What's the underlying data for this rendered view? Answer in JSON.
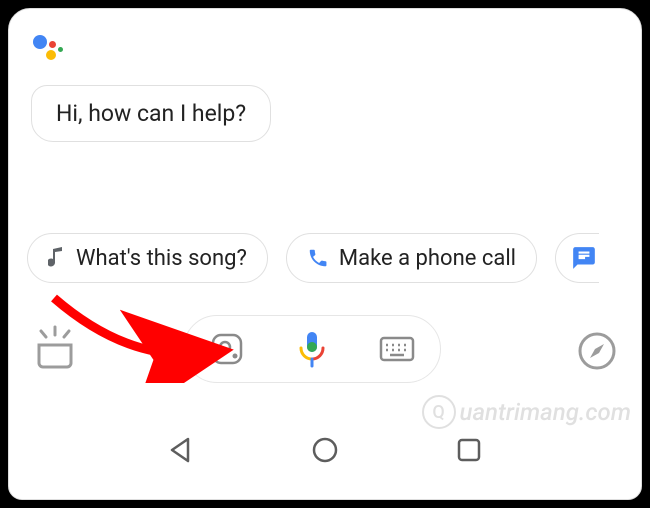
{
  "assistant": {
    "greeting": "Hi, how can I help?"
  },
  "suggestions": [
    {
      "icon": "music-note-icon",
      "label": "What's this song?"
    },
    {
      "icon": "phone-icon",
      "label": "Make a phone call"
    }
  ],
  "input_bar": {
    "lens_label": "lens",
    "mic_label": "voice",
    "keyboard_label": "keyboard"
  },
  "quick": {
    "snapshot_label": "what's on my screen",
    "explore_label": "explore"
  },
  "nav": {
    "back": "back",
    "home": "home",
    "recents": "recent apps"
  },
  "watermark": "uantrimang.com",
  "colors": {
    "google_blue": "#4285F4",
    "google_red": "#EA4335",
    "google_yellow": "#FBBC05",
    "google_green": "#34A853",
    "arrow": "#FF0000"
  }
}
